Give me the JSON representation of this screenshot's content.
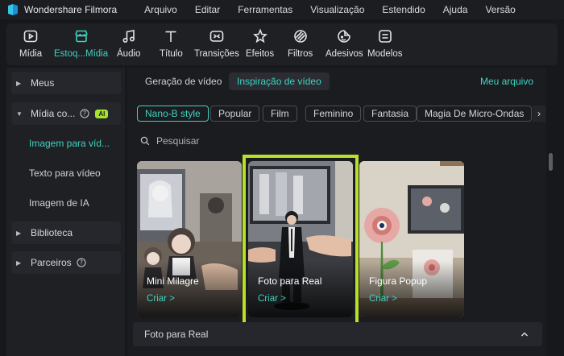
{
  "app": {
    "title": "Wondershare Filmora"
  },
  "menu": [
    "Arquivo",
    "Editar",
    "Ferramentas",
    "Visualização",
    "Estendido",
    "Ajuda",
    "Versão"
  ],
  "toolbar": {
    "items": [
      {
        "label": "Mídia",
        "icon": "media-icon"
      },
      {
        "label": "Estoq...Mídia",
        "icon": "stock-media-icon",
        "active": true
      },
      {
        "label": "Áudio",
        "icon": "audio-icon"
      },
      {
        "label": "Título",
        "icon": "title-icon"
      },
      {
        "label": "Transições",
        "icon": "transitions-icon"
      },
      {
        "label": "Efeitos",
        "icon": "effects-icon"
      },
      {
        "label": "Filtros",
        "icon": "filters-icon"
      },
      {
        "label": "Adesivos",
        "icon": "stickers-icon"
      },
      {
        "label": "Modelos",
        "icon": "templates-icon"
      }
    ]
  },
  "sidebar": {
    "meus": "Meus",
    "midia": "Mídia co...",
    "ai_badge": "AI",
    "sub_items": [
      "Imagem para víd...",
      "Texto para vídeo",
      "Imagem de IA"
    ],
    "biblioteca": "Biblioteca",
    "parceiros": "Parceiros"
  },
  "main": {
    "tabs": [
      "Geração de vídeo",
      "Inspiração de vídeo"
    ],
    "my_file": "Meu arquivo",
    "chips": [
      "Nano-B style",
      "Popular",
      "Film",
      "Feminino",
      "Fantasia",
      "Magia De Micro-Ondas"
    ],
    "search_placeholder": "Pesquisar",
    "cards": [
      {
        "title": "Mini Milagre",
        "action": "Criar  >"
      },
      {
        "title": "Foto para Real",
        "action": "Criar  >"
      },
      {
        "title": "Figura Popup",
        "action": "Criar  >"
      }
    ],
    "bottom_title": "Foto para Real"
  },
  "colors": {
    "accent": "#3fd2c0",
    "highlight": "#b8e02a",
    "ai_badge": "#a6e22e"
  }
}
